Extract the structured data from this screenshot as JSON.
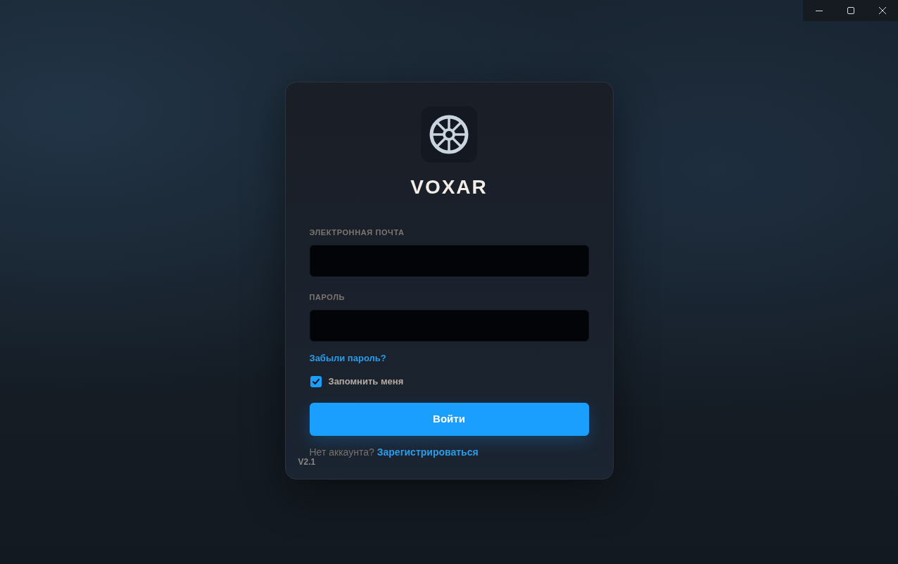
{
  "app": {
    "name": "VOXAR"
  },
  "form": {
    "fields": [
      {
        "label": "ЭЛЕКТРОННАЯ ПОЧТА"
      },
      {
        "label": "ПАРОЛЬ"
      }
    ],
    "forgot_link": "Забыли пароль?",
    "remember": {
      "label": "Запомнить меня",
      "checked": true
    },
    "submit": "Войти",
    "signup": {
      "prompt": "Нет аккаунта?",
      "link": "Зарегистрироваться"
    }
  },
  "version": "V2.1"
}
